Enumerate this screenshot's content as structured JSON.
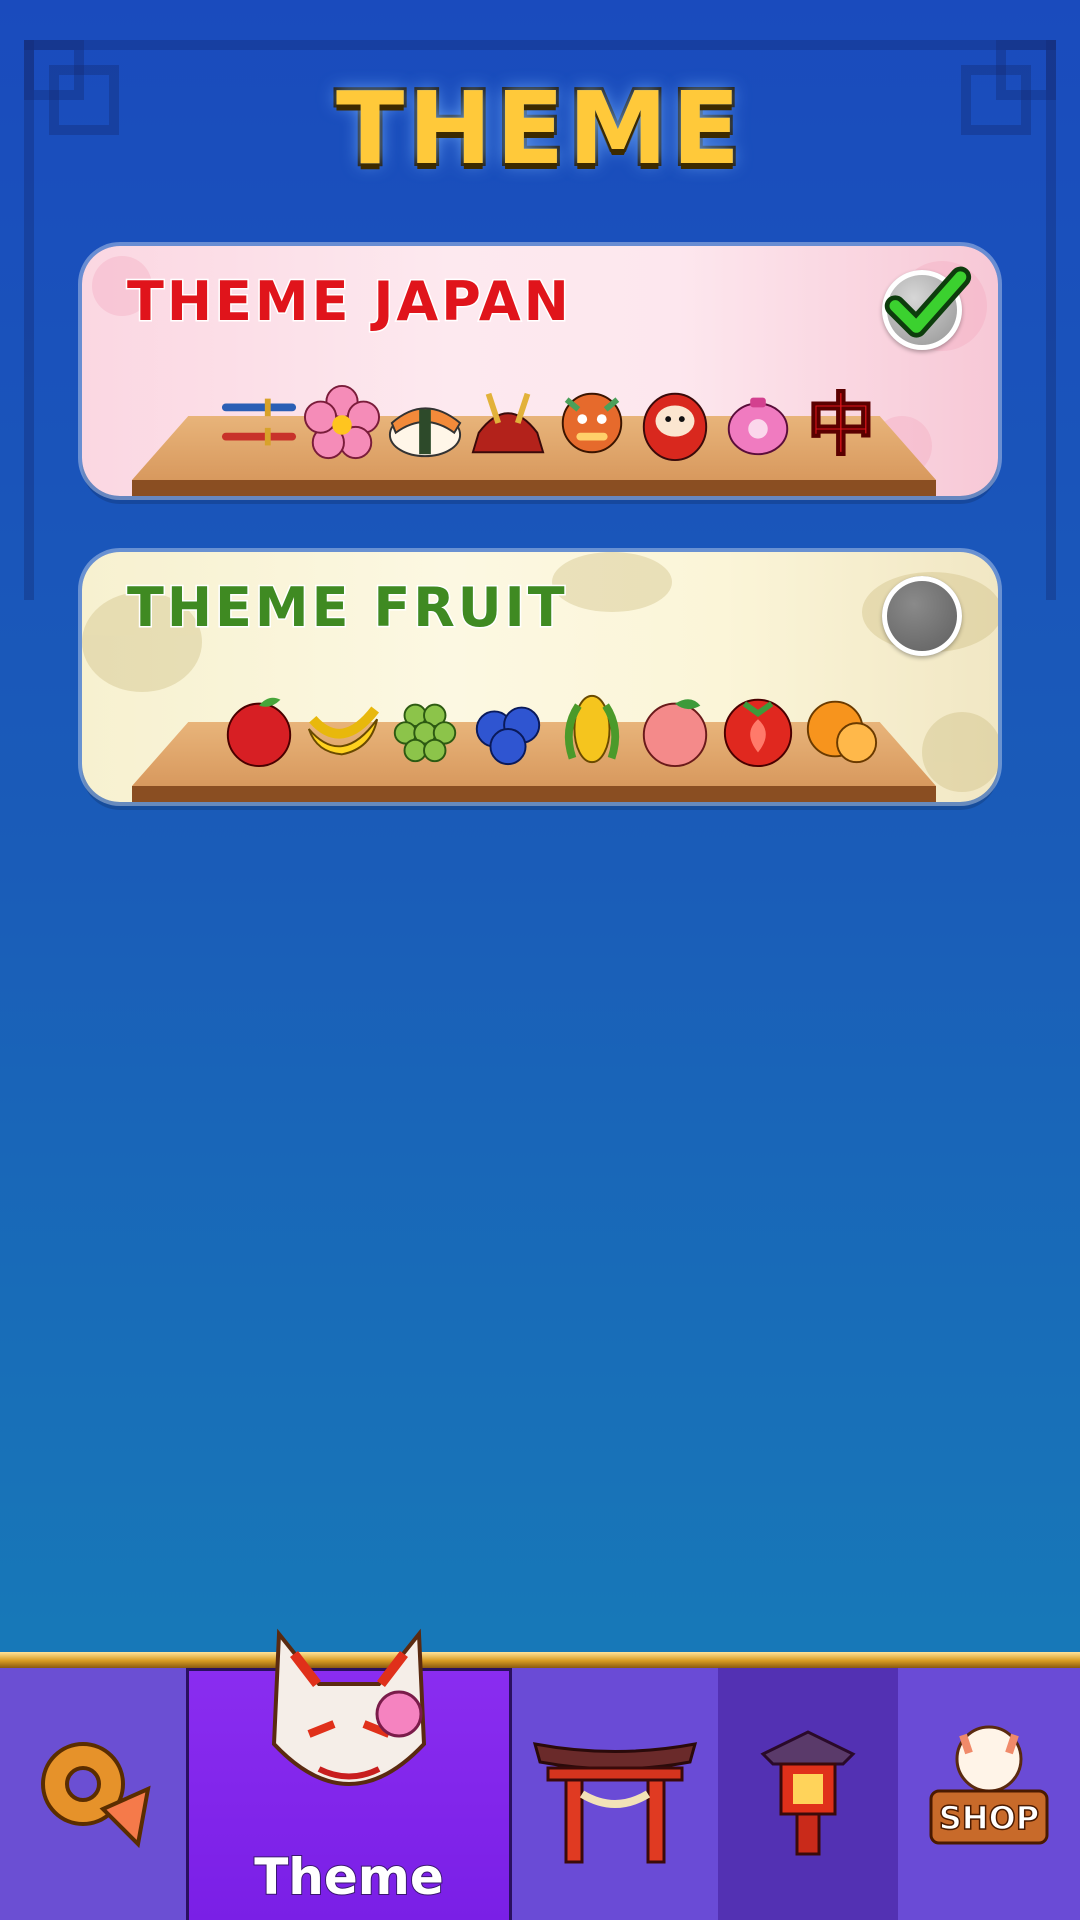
{
  "header": {
    "title": "THEME"
  },
  "themes": [
    {
      "title": "THEME JAPAN",
      "selected": true,
      "items": [
        "katana-icon",
        "sakura-flower-icon",
        "sushi-icon",
        "samurai-helmet-icon",
        "dragon-icon",
        "daruma-icon",
        "teapot-icon",
        "kanji-tile-icon"
      ],
      "kanji": "中"
    },
    {
      "title": "THEME FRUIT",
      "selected": false,
      "items": [
        "apple-icon",
        "banana-icon",
        "grapes-icon",
        "blueberries-icon",
        "corn-icon",
        "peach-icon",
        "tomato-icon",
        "orange-icon"
      ]
    }
  ],
  "nav": {
    "items": [
      {
        "id": "settings",
        "icon": "gear-fan-icon"
      },
      {
        "id": "theme",
        "icon": "kitsune-mask-icon",
        "label": "Theme",
        "active": true
      },
      {
        "id": "torii",
        "icon": "torii-gate-icon"
      },
      {
        "id": "lantern",
        "icon": "lantern-icon"
      },
      {
        "id": "shop",
        "icon": "lucky-cat-icon",
        "badge": "SHOP"
      }
    ]
  },
  "colors": {
    "background": "#1a4bbd",
    "title": "#ffc93a",
    "japan_title": "#e0141b",
    "fruit_title": "#3f8a22",
    "nav": "#6a4bd6",
    "nav_active": "#8a2df0"
  }
}
